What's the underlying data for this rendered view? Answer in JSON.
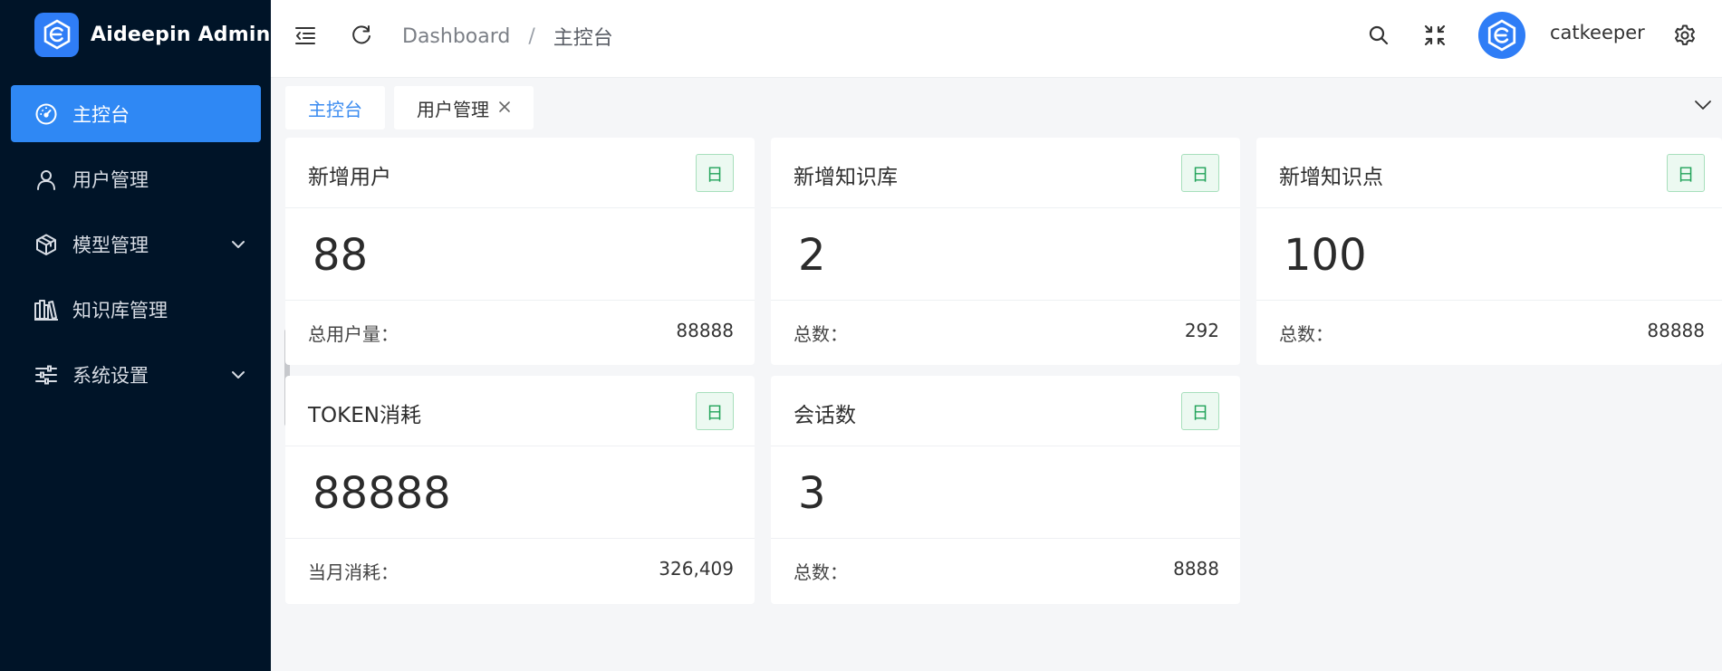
{
  "brand": {
    "title": "Aideepin Admin",
    "logo_icon": "app-logo-icon"
  },
  "sidebar": {
    "items": [
      {
        "label": "主控台",
        "icon": "dashboard-gauge-icon",
        "active": true,
        "has_children": false
      },
      {
        "label": "用户管理",
        "icon": "user-icon",
        "active": false,
        "has_children": false
      },
      {
        "label": "模型管理",
        "icon": "cube-icon",
        "active": false,
        "has_children": true
      },
      {
        "label": "知识库管理",
        "icon": "library-icon",
        "active": false,
        "has_children": false
      },
      {
        "label": "系统设置",
        "icon": "sliders-icon",
        "active": false,
        "has_children": true
      }
    ]
  },
  "header": {
    "breadcrumb": {
      "root": "Dashboard",
      "separator": "/",
      "current": "主控台"
    },
    "username": "catkeeper"
  },
  "tabs": {
    "items": [
      {
        "label": "主控台",
        "active": true,
        "closable": false
      },
      {
        "label": "用户管理",
        "active": false,
        "closable": true
      }
    ]
  },
  "cards": [
    {
      "title": "新增用户",
      "badge": "日",
      "value": "88",
      "foot_label": "总用户量：",
      "foot_value": "88888"
    },
    {
      "title": "新增知识库",
      "badge": "日",
      "value": "2",
      "foot_label": "总数：",
      "foot_value": "292"
    },
    {
      "title": "新增知识点",
      "badge": "日",
      "value": "100",
      "foot_label": "总数：",
      "foot_value": "88888"
    },
    {
      "title": "TOKEN消耗",
      "badge": "日",
      "value": "88888",
      "foot_label": "当月消耗：",
      "foot_value": "326,409"
    },
    {
      "title": "会话数",
      "badge": "日",
      "value": "3",
      "foot_label": "总数：",
      "foot_value": "8888"
    }
  ],
  "colors": {
    "sidebar_bg": "#001428",
    "accent": "#2f88f4",
    "badge_green": "#22a35a",
    "page_bg": "#f5f6f8"
  }
}
